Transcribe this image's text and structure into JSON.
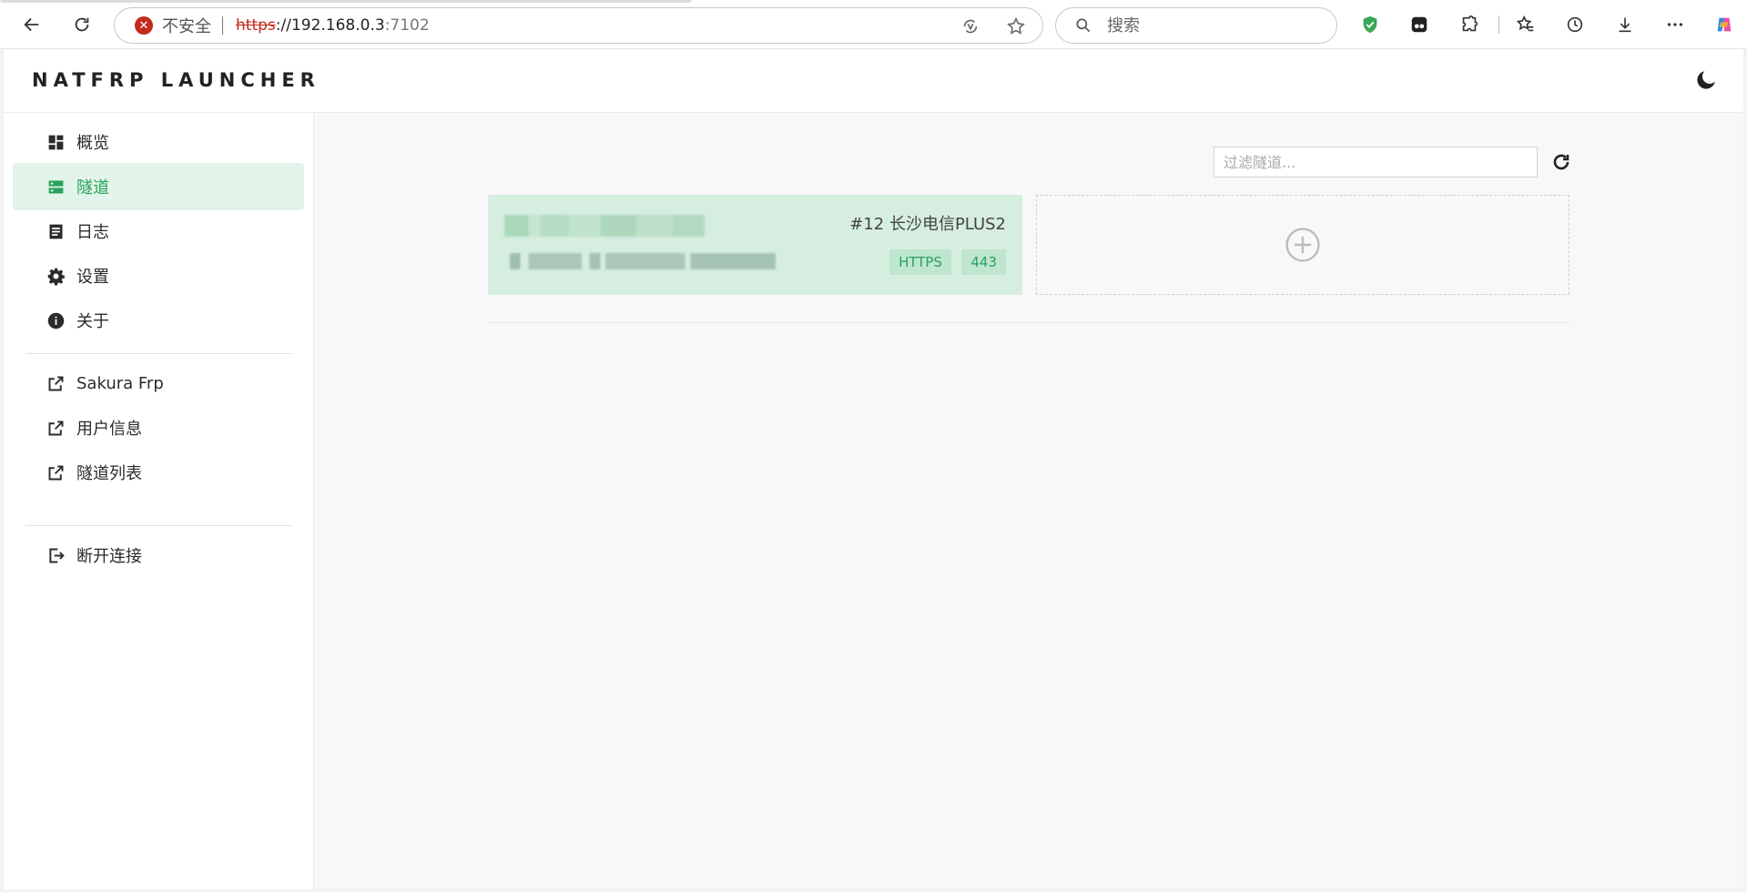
{
  "browser": {
    "insecure_label": "不安全",
    "url_protocol": "https",
    "url_rest": "://192.168.0.3",
    "url_port": ":7102",
    "search_placeholder": "搜索"
  },
  "app": {
    "title": "NATFRP LAUNCHER",
    "accent_color": "#27a35b"
  },
  "sidebar": {
    "items": [
      {
        "label": "概览",
        "icon": "dashboard-icon",
        "active": false
      },
      {
        "label": "隧道",
        "icon": "server-icon",
        "active": true
      },
      {
        "label": "日志",
        "icon": "document-icon",
        "active": false
      },
      {
        "label": "设置",
        "icon": "gear-icon",
        "active": false
      },
      {
        "label": "关于",
        "icon": "info-icon",
        "active": false
      }
    ],
    "links": [
      {
        "label": "Sakura Frp",
        "icon": "external-link-icon"
      },
      {
        "label": "用户信息",
        "icon": "external-link-icon"
      },
      {
        "label": "隧道列表",
        "icon": "external-link-icon"
      }
    ],
    "logout": {
      "label": "断开连接",
      "icon": "logout-icon"
    }
  },
  "main": {
    "filter_placeholder": "过滤隧道...",
    "tunnels": [
      {
        "node": "#12 长沙电信PLUS2",
        "type": "HTTPS",
        "port": "443"
      }
    ]
  }
}
